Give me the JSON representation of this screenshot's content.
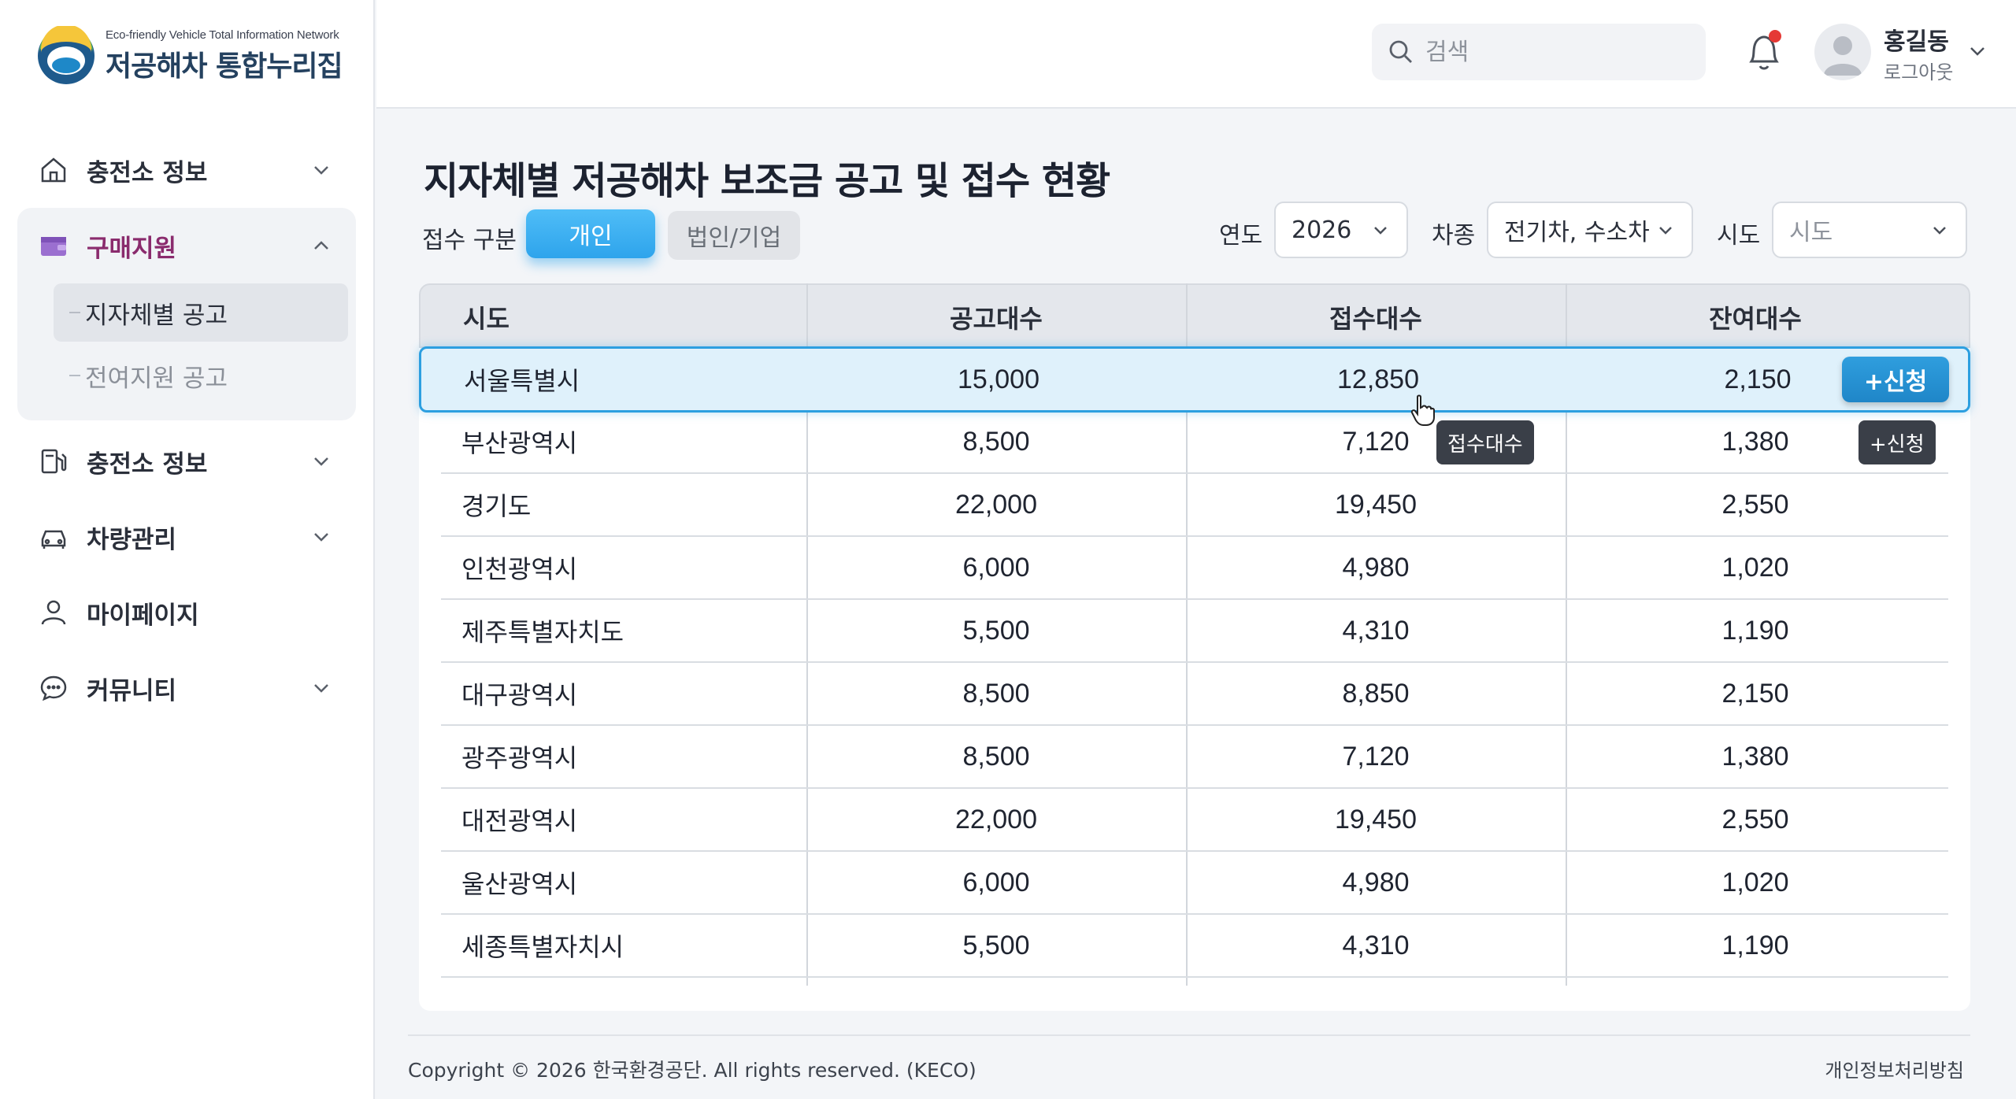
{
  "logo": {
    "subtitle": "Eco-friendly Vehicle Total Information Network",
    "title": "저공해차 통합누리집"
  },
  "sidebar": {
    "items": [
      {
        "label": "충전소 정보"
      },
      {
        "label": "구매지원",
        "sub": [
          {
            "label": "지자체별 공고"
          },
          {
            "label": "전여지원 공고"
          }
        ]
      },
      {
        "label": "충전소 정보"
      },
      {
        "label": "차량관리"
      },
      {
        "label": "마이페이지"
      },
      {
        "label": "커뮤니티"
      }
    ]
  },
  "header": {
    "search_placeholder": "검색",
    "user_name": "홍길동",
    "logout": "로그아웃"
  },
  "main": {
    "title": "지자체별 저공해차 보조금 공고 및 접수 현황",
    "filter": {
      "type_label": "접수 구분",
      "type_options": [
        "개인",
        "법인/기업"
      ],
      "year_label": "연도",
      "year_value": "2026",
      "vehicle_label": "차종",
      "vehicle_value": "전기차, 수소차",
      "region_label": "시도",
      "region_placeholder": "시도"
    },
    "table": {
      "columns": [
        "시도",
        "공고대수",
        "접수대수",
        "잔여대수"
      ],
      "rows": [
        [
          "서울특별시",
          "15,000",
          "12,850",
          "2,150"
        ],
        [
          "부산광역시",
          "8,500",
          "7,120",
          "1,380"
        ],
        [
          "경기도",
          "22,000",
          "19,450",
          "2,550"
        ],
        [
          "인천광역시",
          "6,000",
          "4,980",
          "1,020"
        ],
        [
          "제주특별자치도",
          "5,500",
          "4,310",
          "1,190"
        ],
        [
          "대구광역시",
          "8,500",
          "8,850",
          "2,150"
        ],
        [
          "광주광역시",
          "8,500",
          "7,120",
          "1,380"
        ],
        [
          "대전광역시",
          "22,000",
          "19,450",
          "2,550"
        ],
        [
          "울산광역시",
          "6,000",
          "4,980",
          "1,020"
        ],
        [
          "세종특별자치시",
          "5,500",
          "4,310",
          "1,190"
        ]
      ],
      "apply_label": "+신청",
      "tooltip_received": "접수대수",
      "tooltip_apply": "+신청"
    }
  },
  "footer": {
    "copyright": "Copyright © 2026 한국환경공단. All rights reserved. (KECO)",
    "privacy": "개인정보처리방침"
  },
  "colors": {
    "accent": "#2ea4ec",
    "highlight_row": "#dff1fb",
    "active_menu": "#8a2b6d",
    "notification": "#e53935"
  }
}
